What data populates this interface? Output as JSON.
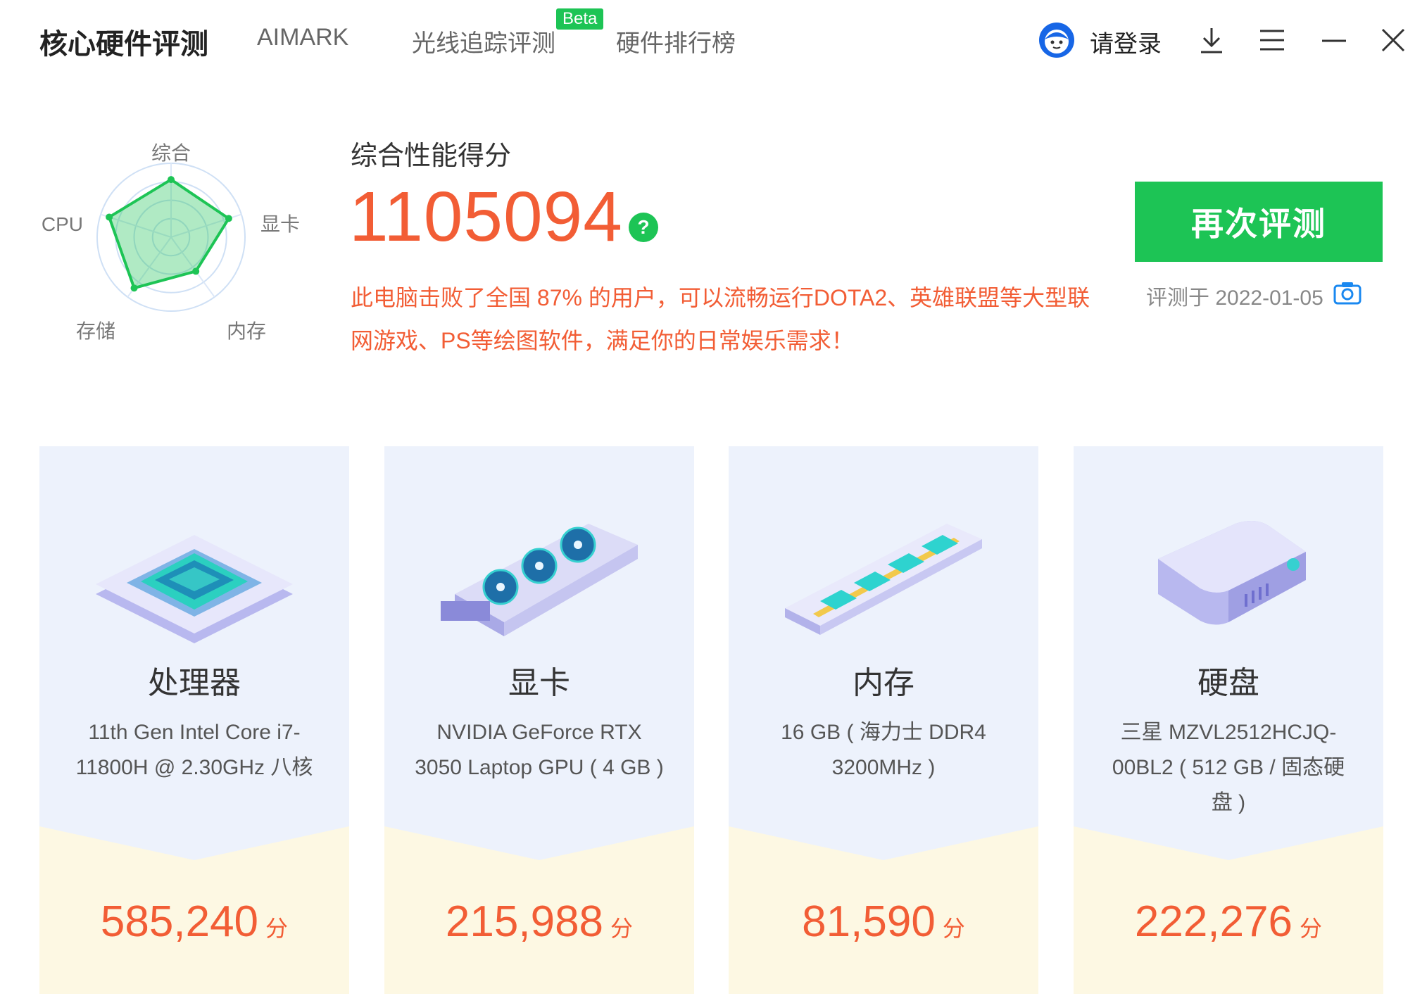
{
  "nav": {
    "title": "核心硬件评测",
    "tabs": [
      "AIMARK",
      "光线追踪评测",
      "硬件排行榜"
    ],
    "beta_badge": "Beta",
    "login_label": "请登录",
    "icons": [
      "avatar-icon",
      "download-icon",
      "menu-icon",
      "minimize-icon",
      "close-icon"
    ]
  },
  "radar": {
    "axes": [
      "综合",
      "显卡",
      "内存",
      "存储",
      "CPU"
    ],
    "values": [
      0.78,
      0.82,
      0.57,
      0.85,
      0.88
    ],
    "accent": "#1dc455"
  },
  "summary": {
    "label": "综合性能得分",
    "score": "1105094",
    "help_icon": "?",
    "description": "此电脑击败了全国 87% 的用户，可以流畅运行DOTA2、英雄联盟等大型联网游戏、PS等绘图软件，满足你的日常娱乐需求！",
    "retest_label": "再次评测",
    "tested_on": "评测于 2022-01-05",
    "score_color": "#f25d35"
  },
  "cards": [
    {
      "name": "处理器",
      "detail": "11th Gen Intel Core i7-11800H @ 2.30GHz 八核",
      "score": "585,240",
      "unit": "分",
      "icon": "cpu-chip-icon"
    },
    {
      "name": "显卡",
      "detail": "NVIDIA GeForce RTX 3050 Laptop GPU ( 4 GB )",
      "score": "215,988",
      "unit": "分",
      "icon": "graphics-card-icon"
    },
    {
      "name": "内存",
      "detail": "16 GB ( 海力士 DDR4 3200MHz )",
      "score": "81,590",
      "unit": "分",
      "icon": "memory-stick-icon"
    },
    {
      "name": "硬盘",
      "detail": "三星 MZVL2512HCJQ-00BL2 ( 512 GB / 固态硬盘 )",
      "score": "222,276",
      "unit": "分",
      "icon": "hard-drive-icon"
    }
  ]
}
